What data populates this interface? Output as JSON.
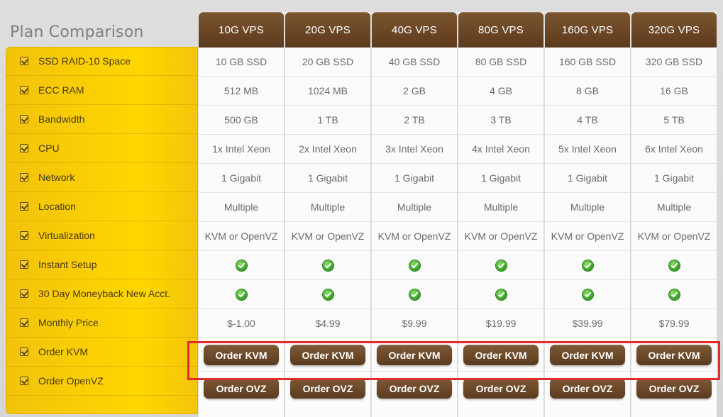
{
  "page": {
    "title": "Plan Comparison"
  },
  "features": [
    "SSD RAID-10 Space",
    "ECC RAM",
    "Bandwidth",
    "CPU",
    "Network",
    "Location",
    "Virtualization",
    "Instant Setup",
    "30 Day Moneyback New Acct.",
    "Monthly Price",
    "Order KVM",
    "Order OpenVZ"
  ],
  "plans": [
    {
      "name": "10G VPS",
      "cells": [
        "10 GB SSD",
        "512 MB",
        "500 GB",
        "1x Intel Xeon",
        "1 Gigabit",
        "Multiple",
        "KVM or OpenVZ",
        "check",
        "check",
        "$-1.00"
      ],
      "order_kvm": "Order KVM",
      "order_ovz": "Order OVZ"
    },
    {
      "name": "20G VPS",
      "cells": [
        "20 GB SSD",
        "1024 MB",
        "1 TB",
        "2x Intel Xeon",
        "1 Gigabit",
        "Multiple",
        "KVM or OpenVZ",
        "check",
        "check",
        "$4.99"
      ],
      "order_kvm": "Order KVM",
      "order_ovz": "Order OVZ"
    },
    {
      "name": "40G VPS",
      "cells": [
        "40 GB SSD",
        "2 GB",
        "2 TB",
        "3x Intel Xeon",
        "1 Gigabit",
        "Multiple",
        "KVM or OpenVZ",
        "check",
        "check",
        "$9.99"
      ],
      "order_kvm": "Order KVM",
      "order_ovz": "Order OVZ"
    },
    {
      "name": "80G VPS",
      "cells": [
        "80 GB SSD",
        "4 GB",
        "3 TB",
        "4x Intel Xeon",
        "1 Gigabit",
        "Multiple",
        "KVM or OpenVZ",
        "check",
        "check",
        "$19.99"
      ],
      "order_kvm": "Order KVM",
      "order_ovz": "Order OVZ"
    },
    {
      "name": "160G VPS",
      "cells": [
        "160 GB SSD",
        "8 GB",
        "4 TB",
        "5x Intel Xeon",
        "1 Gigabit",
        "Multiple",
        "KVM or OpenVZ",
        "check",
        "check",
        "$39.99"
      ],
      "order_kvm": "Order KVM",
      "order_ovz": "Order OVZ"
    },
    {
      "name": "320G VPS",
      "cells": [
        "320 GB SSD",
        "16 GB",
        "5 TB",
        "6x Intel Xeon",
        "1 Gigabit",
        "Multiple",
        "KVM or OpenVZ",
        "check",
        "check",
        "$79.99"
      ],
      "order_kvm": "Order KVM",
      "order_ovz": "Order OVZ"
    }
  ],
  "icons": {
    "feature_checkbox": "checkbox-checked-icon",
    "included": "green-check-icon"
  },
  "colors": {
    "feature_panel": "#ffd700",
    "plan_header": "#6a4524",
    "button": "#6b4929",
    "highlight": "#e22b2b"
  }
}
